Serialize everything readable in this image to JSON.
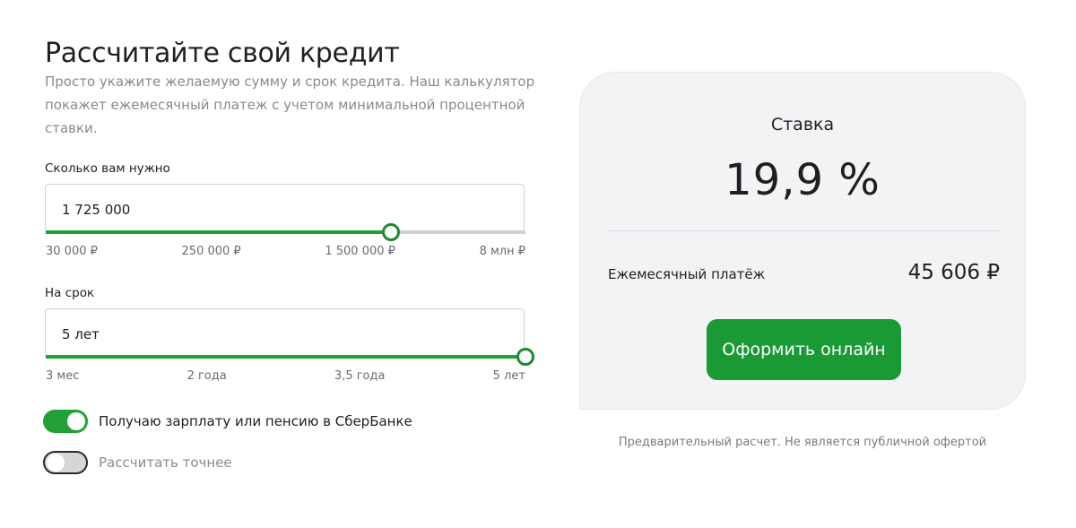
{
  "header": {
    "title": "Рассчитайте свой кредит",
    "description": "Просто укажите желаемую сумму и срок кредита. Наш калькулятор покажет ежемесячный платеж с учетом минимальной процентной ставки."
  },
  "amount": {
    "label": "Сколько вам нужно",
    "value": "1 725 000",
    "slider_fraction": 0.72,
    "ticks": [
      "30 000 ₽",
      "250 000 ₽",
      "1 500 000 ₽",
      "8 млн ₽"
    ]
  },
  "term": {
    "label": "На срок",
    "value": "5 лет",
    "slider_fraction": 1.0,
    "ticks": [
      "3 мес",
      "2 года",
      "3,5 года",
      "5 лет"
    ]
  },
  "toggles": [
    {
      "label": "Получаю зарплату или пенсию в СберБанке",
      "state": "on"
    },
    {
      "label": "Рассчитать точнее",
      "state": "off"
    }
  ],
  "result": {
    "rate_label": "Ставка",
    "rate_value": "19,9 %",
    "payment_label": "Ежемесячный платёж",
    "payment_value": "45 606 ₽",
    "apply_label": "Оформить онлайн"
  },
  "disclaimer": "Предварительный расчет. Не является публичной офертой",
  "colors": {
    "accent": "#21a038",
    "button": "#1a9a34",
    "card_bg": "#f2f3f5"
  }
}
